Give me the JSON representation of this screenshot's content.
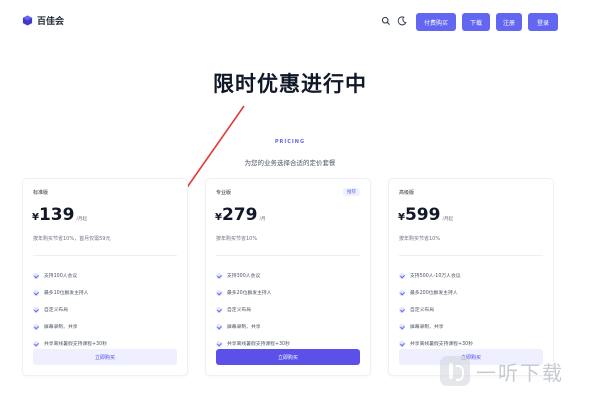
{
  "header": {
    "brand": "百佳会",
    "buttons": {
      "btn1": "付费购买",
      "btn2": "下载",
      "btn3": "注册",
      "btn4": "登录"
    }
  },
  "hero": {
    "title": "限时优惠进行中",
    "eyebrow": "PRICING",
    "subtitle": "为您的业务选择合适的定价套餐"
  },
  "plans": [
    {
      "name": "标准版",
      "badge": "",
      "currency": "¥",
      "price": "139",
      "unit": "/月起",
      "note": "按年购买节省10%，首月仅需59元",
      "features": [
        "支持100人会议",
        "最多10位群发主持人",
        "自定义布局",
        "屏幕录制、共享",
        "共享离线暑假支持课程+30秒"
      ],
      "button": "立即购买"
    },
    {
      "name": "专业版",
      "badge": "推荐",
      "currency": "¥",
      "price": "279",
      "unit": "/月",
      "note": "按年购买节省10%",
      "features": [
        "支持300人会议",
        "最多20位群发主持人",
        "自定义布局",
        "屏幕录制、共享",
        "共享离线暑假支持课程+30秒"
      ],
      "button": "立即购买"
    },
    {
      "name": "高级版",
      "badge": "",
      "currency": "¥",
      "price": "599",
      "unit": "/月起",
      "note": "按年购买节省10%",
      "features": [
        "支持500人-10万人会议",
        "最多200位群发主持人",
        "自定义布局",
        "屏幕录制、共享",
        "共享离线暑假支持课程+30秒"
      ],
      "button": "立即购买"
    }
  ],
  "watermark": {
    "text": "一听下载"
  },
  "colors": {
    "accent": "#6366f1",
    "arrow": "#e53935"
  },
  "icons": {
    "brand": "cube-logo-icon",
    "search": "search-icon",
    "theme": "moon-icon",
    "feature": "check-icon"
  }
}
